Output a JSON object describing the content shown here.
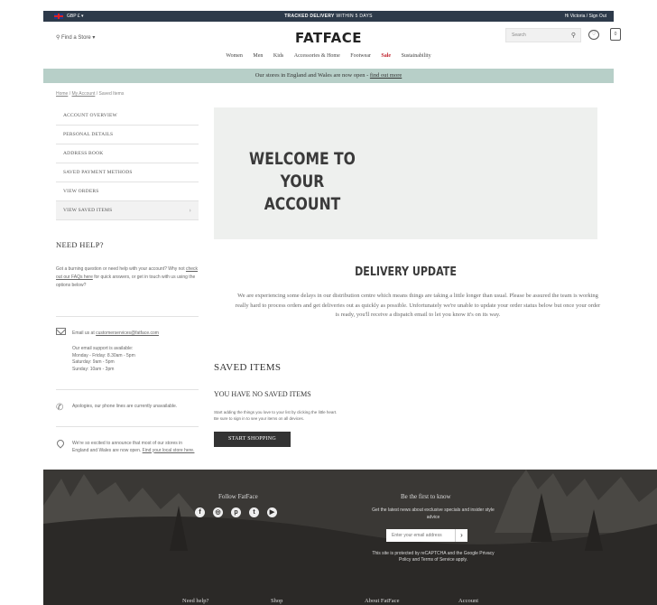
{
  "topbar": {
    "currency": "GBP £ ▾",
    "promo_strong": "TRACKED DELIVERY",
    "promo_rest": " WITHIN 5 DAYS",
    "account": "Hi Victoria / Sign Out"
  },
  "header": {
    "find_store": "⚲ Find a Store ▾",
    "logo": "FATFACE",
    "search_placeholder": "Search",
    "bag_count": "0"
  },
  "nav": {
    "items": [
      "Women",
      "Men",
      "Kids",
      "Accessories & Home",
      "Footwear",
      "Sale",
      "Sustainability"
    ]
  },
  "banner": {
    "text": "Our stores in England and Wales are now open - ",
    "link": "find out more"
  },
  "breadcrumb": {
    "home": "Home",
    "sep1": " / ",
    "account": "My Account",
    "sep2": " / ",
    "current": "Saved Items"
  },
  "account_menu": {
    "items": [
      "ACCOUNT OVERVIEW",
      "PERSONAL DETAILS",
      "ADDRESS BOOK",
      "SAVED PAYMENT METHODS",
      "VIEW ORDERS",
      "VIEW SAVED ITEMS"
    ]
  },
  "help": {
    "title": "NEED HELP?",
    "intro_1": "Got a burning question or need help with your account? Why not ",
    "intro_link": "check out our FAQs here",
    "intro_2": " for quick answers, or get in touch with us using the options below?",
    "email_prefix": "Email us at ",
    "email": "customerservices@fatface.com",
    "hours": [
      "Our email support is available:",
      "Monday - Friday: 8.30am - 5pm",
      "Saturday: 9am - 5pm",
      "Sunday: 10am - 3pm"
    ],
    "phone": "Apologies, our phone lines are currently unavailable.",
    "stores_text": "We're so excited to announce that most of our stores in England and Wales are now open. ",
    "stores_link": "Find your local store here."
  },
  "hero": {
    "line1": "WELCOME TO YOUR",
    "line2": "ACCOUNT"
  },
  "delivery": {
    "title": "DELIVERY UPDATE",
    "body": "We are experiencing some delays in our distribution centre which means things are taking a little longer than usual. Please be assured the team is working really hard to process orders and get deliveries out as quickly as possible. Unfortunately we're unable to update your order status below but once your order is ready, you'll receive a dispatch email to let you know it's on its way."
  },
  "saved": {
    "title": "SAVED ITEMS",
    "empty": "YOU HAVE NO SAVED ITEMS",
    "hint1": "Start adding the things you love to your list by clicking the little heart.",
    "hint2": "Be sure to sign in to see your items on all devices.",
    "button": "START SHOPPING"
  },
  "footer": {
    "follow": "Follow FatFace",
    "first_to_know": "Be the first to know",
    "latest": "Get the latest news about exclusive specials and insider style advice",
    "email_placeholder": "Enter your email address",
    "recaptcha": "This site is protected by reCAPTCHA and the Google Privacy Policy and Terms of Service apply.",
    "links": [
      "Need help?",
      "Shop",
      "About FatFace",
      "Account"
    ]
  },
  "colors": {
    "topbar": "#2d3a4a",
    "banner": "#b7cfc8",
    "sale": "#c0202b",
    "footer": "#2e2c2a"
  }
}
